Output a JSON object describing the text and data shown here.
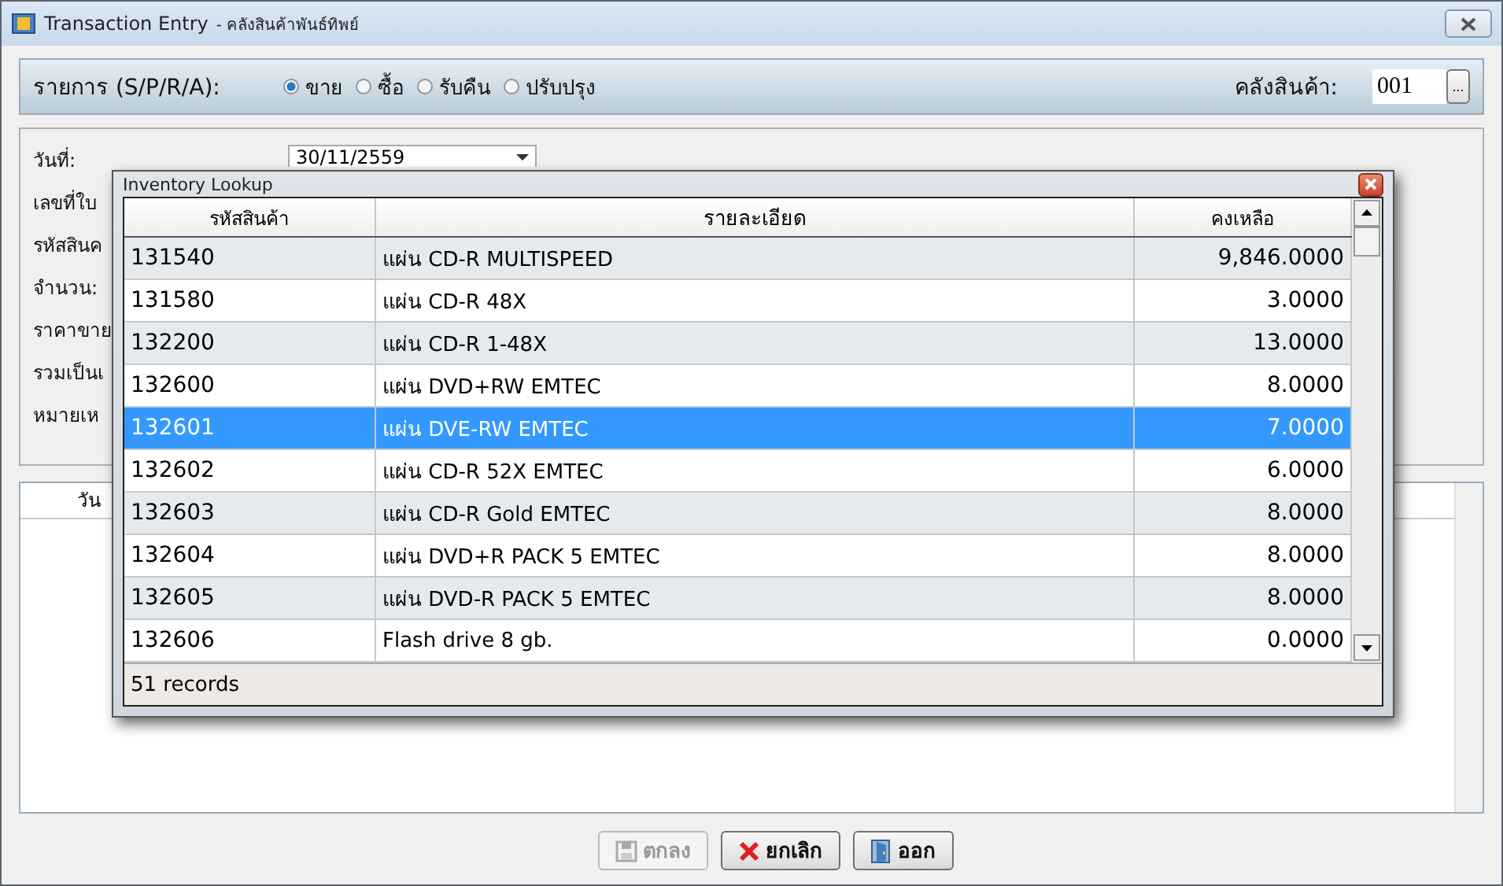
{
  "window": {
    "title": "Transaction Entry",
    "subtitle": "- คลังสินค้าพันธ์ทิพย์"
  },
  "type_bar": {
    "label": "รายการ (S/P/R/A):",
    "options": [
      {
        "label": "ขาย",
        "selected": true
      },
      {
        "label": "ซื้อ",
        "selected": false
      },
      {
        "label": "รับคืน",
        "selected": false
      },
      {
        "label": "ปรับปรุง",
        "selected": false
      }
    ],
    "warehouse_label": "คลังสินค้า:",
    "warehouse_value": "001",
    "browse_button": "..."
  },
  "form": {
    "labels": [
      "วันที่:",
      "เลขที่ใบ",
      "รหัสสินค",
      "จำนวน:",
      "ราคาขาย",
      "รวมเป็นเ",
      "หมายเห"
    ],
    "date_value": "30/11/2559"
  },
  "grid": {
    "columns": [
      "วัน"
    ]
  },
  "buttons": [
    {
      "label": "ตกลง",
      "kind": "save",
      "disabled": true
    },
    {
      "label": "ยกเลิก",
      "kind": "cancel",
      "disabled": false
    },
    {
      "label": "ออก",
      "kind": "exit",
      "disabled": false
    }
  ],
  "dialog": {
    "title": "Inventory Lookup",
    "columns": [
      "รหัสสินค้า",
      "รายละเอียด",
      "คงเหลือ"
    ],
    "rows": [
      {
        "code": "131540",
        "description": "แผ่น CD-R MULTISPEED",
        "balance": "9,846.0000",
        "selected": false
      },
      {
        "code": "131580",
        "description": "แผ่น CD-R 48X",
        "balance": "3.0000",
        "selected": false
      },
      {
        "code": "132200",
        "description": "แผ่น CD-R 1-48X",
        "balance": "13.0000",
        "selected": false
      },
      {
        "code": "132600",
        "description": "แผ่น DVD+RW EMTEC",
        "balance": "8.0000",
        "selected": false
      },
      {
        "code": "132601",
        "description": "แผ่น DVE-RW EMTEC",
        "balance": "7.0000",
        "selected": true
      },
      {
        "code": "132602",
        "description": "แผ่น CD-R 52X EMTEC",
        "balance": "6.0000",
        "selected": false
      },
      {
        "code": "132603",
        "description": "แผ่น CD-R Gold EMTEC",
        "balance": "8.0000",
        "selected": false
      },
      {
        "code": "132604",
        "description": "แผ่น DVD+R PACK 5 EMTEC",
        "balance": "8.0000",
        "selected": false
      },
      {
        "code": "132605",
        "description": "แผ่น DVD-R PACK 5 EMTEC",
        "balance": "8.0000",
        "selected": false
      },
      {
        "code": "132606",
        "description": "Flash drive 8 gb.",
        "balance": "0.0000",
        "selected": false
      }
    ],
    "record_count": "51 records"
  }
}
